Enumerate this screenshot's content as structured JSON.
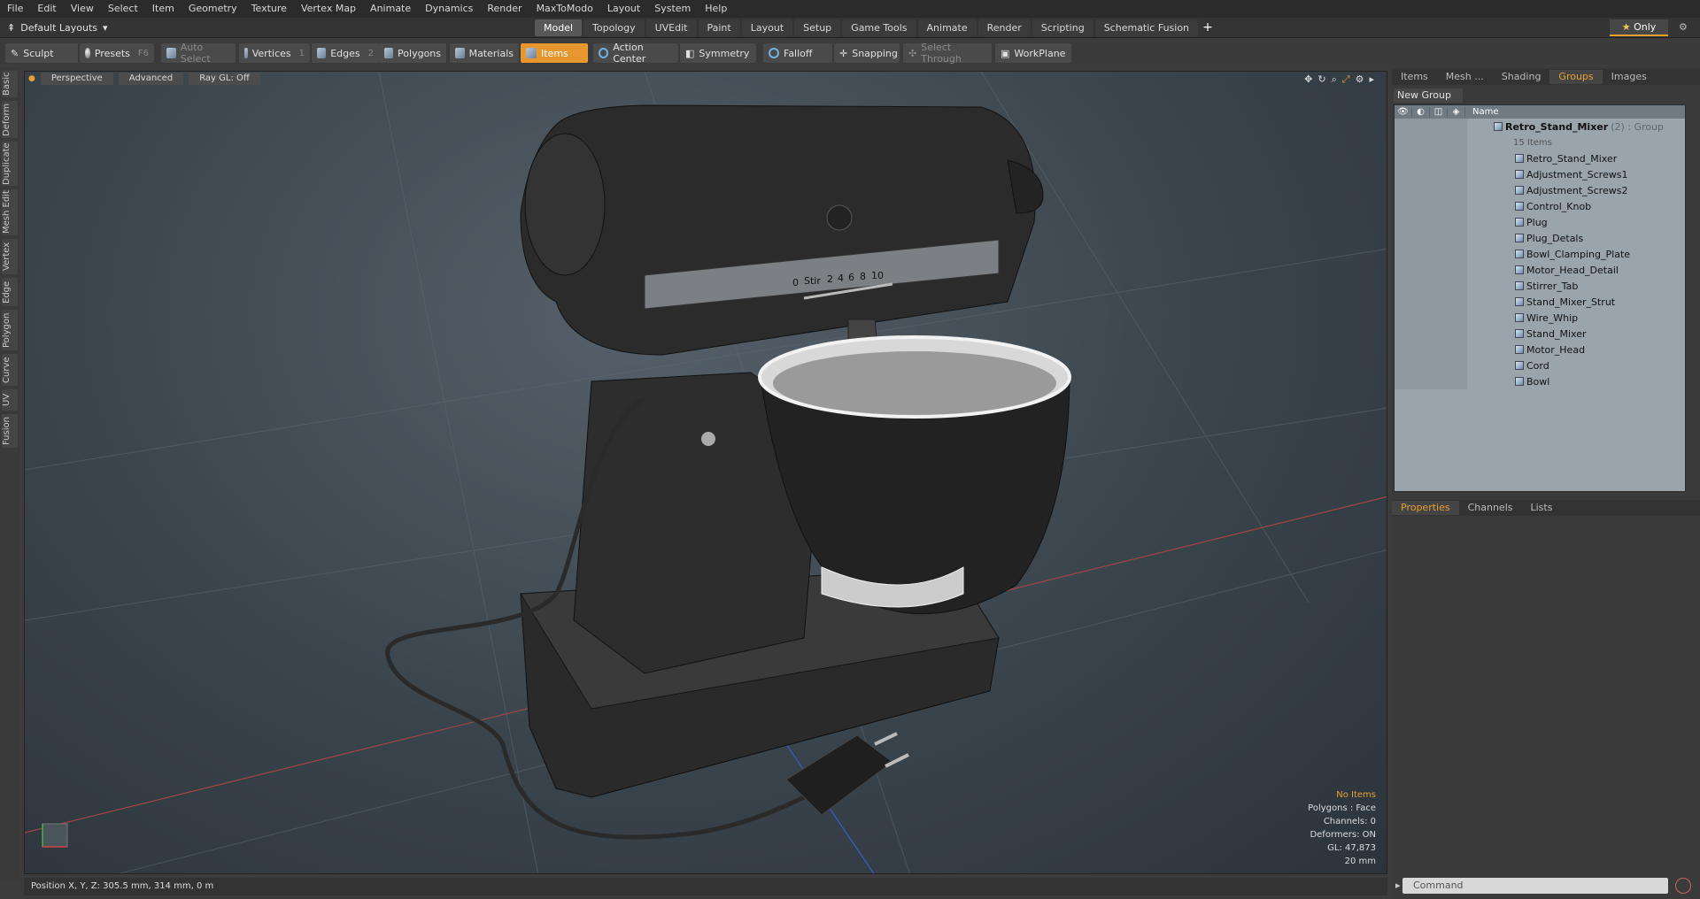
{
  "menu": [
    "File",
    "Edit",
    "View",
    "Select",
    "Item",
    "Geometry",
    "Texture",
    "Vertex Map",
    "Animate",
    "Dynamics",
    "Render",
    "MaxToModo",
    "Layout",
    "System",
    "Help"
  ],
  "layout": {
    "selector": "Default Layouts",
    "tabs": [
      "Model",
      "Topology",
      "UVEdit",
      "Paint",
      "Layout",
      "Setup",
      "Game Tools",
      "Animate",
      "Render",
      "Scripting",
      "Schematic Fusion"
    ],
    "only_label": "Only"
  },
  "toolbar": {
    "sculpt": "Sculpt",
    "presets": "Presets",
    "presets_key": "F6",
    "auto_select": "Auto Select",
    "vertices": "Vertices",
    "vertices_key": "1",
    "edges": "Edges",
    "edges_key": "2",
    "polygons": "Polygons",
    "materials": "Materials",
    "items": "Items",
    "action_center": "Action Center",
    "symmetry": "Symmetry",
    "falloff": "Falloff",
    "snapping": "Snapping",
    "select_through": "Select Through",
    "workplane": "WorkPlane"
  },
  "left_tabs": [
    "Basic",
    "Deform",
    "Duplicate",
    "Mesh Edit",
    "Vertex",
    "Edge",
    "Polygon",
    "Curve",
    "UV",
    "Fusion"
  ],
  "viewport": {
    "view": "Perspective",
    "shading": "Advanced",
    "raygl": "Ray GL: Off",
    "dial_labels": [
      "0",
      "Stir",
      "2",
      "4",
      "6",
      "8",
      "10"
    ],
    "info": {
      "selection": "No Items",
      "polygons": "Polygons : Face",
      "channels": "Channels: 0",
      "deformers": "Deformers: ON",
      "gl": "GL: 47,873",
      "scale": "20 mm"
    }
  },
  "status": {
    "position": "Position X, Y, Z:   305.5 mm, 314 mm, 0 m"
  },
  "right_panel": {
    "top_tabs": [
      "Items",
      "Mesh ...",
      "Shading",
      "Groups",
      "Images"
    ],
    "active_top_tab": "Groups",
    "new_group": "New Group",
    "name_header": "Name",
    "group_name": "Retro_Stand_Mixer",
    "group_suffix": "(2) : Group",
    "group_count": "15 Items",
    "items": [
      "Retro_Stand_Mixer",
      "Adjustment_Screws1",
      "Adjustment_Screws2",
      "Control_Knob",
      "Plug",
      "Plug_Detals",
      "Bowl_Clamping_Plate",
      "Motor_Head_Detail",
      "Stirrer_Tab",
      "Stand_Mixer_Strut",
      "Wire_Whip",
      "Stand_Mixer",
      "Motor_Head",
      "Cord",
      "Bowl"
    ],
    "bottom_tabs": [
      "Properties",
      "Channels",
      "Lists"
    ],
    "command_placeholder": "Command"
  }
}
